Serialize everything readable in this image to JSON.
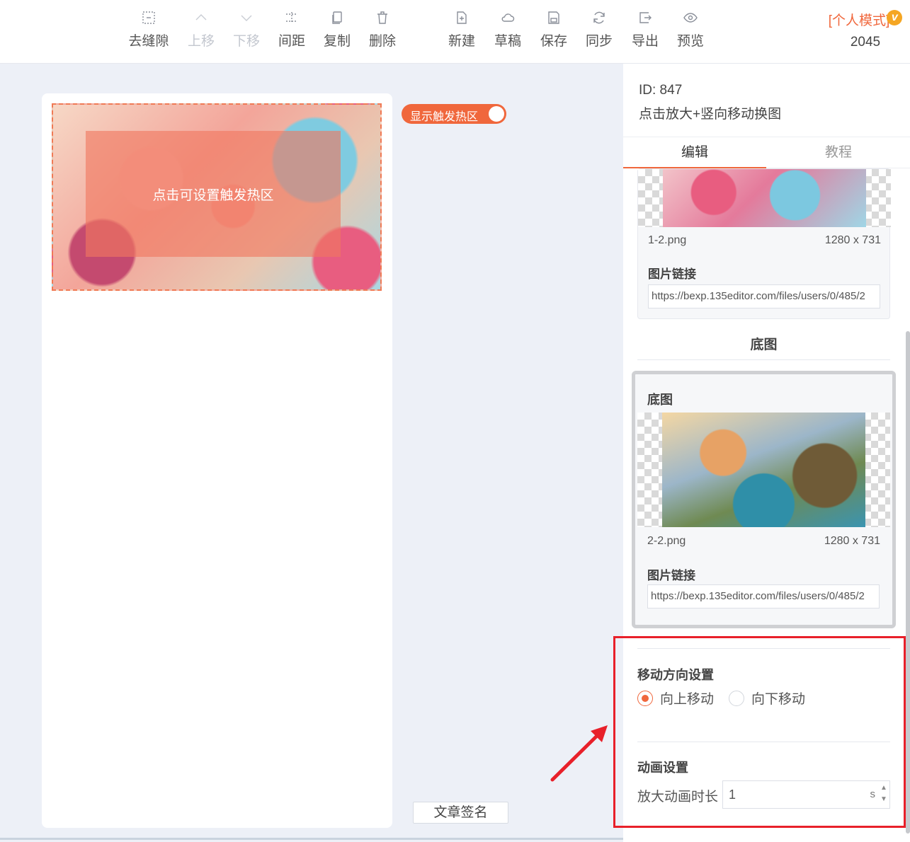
{
  "toolbar": {
    "buttons": [
      {
        "label": "去缝隙",
        "icon": "gap-icon"
      },
      {
        "label": "上移",
        "icon": "chevron-up-icon"
      },
      {
        "label": "下移",
        "icon": "chevron-down-icon"
      },
      {
        "label": "间距",
        "icon": "spacing-icon"
      },
      {
        "label": "复制",
        "icon": "copy-icon"
      },
      {
        "label": "删除",
        "icon": "trash-icon"
      },
      {
        "label": "新建",
        "icon": "new-file-icon"
      },
      {
        "label": "草稿",
        "icon": "cloud-icon"
      },
      {
        "label": "保存",
        "icon": "save-icon"
      },
      {
        "label": "同步",
        "icon": "sync-icon"
      },
      {
        "label": "导出",
        "icon": "export-icon"
      },
      {
        "label": "预览",
        "icon": "eye-icon"
      }
    ],
    "mode_label": "[个人模式]",
    "badge": "v",
    "count": "2045"
  },
  "canvas": {
    "hotzone_text": "点击可设置触发热区",
    "toggle_label": "显示触发热区",
    "sign_button": "文章签名"
  },
  "panel": {
    "id_text": "ID: 847",
    "title": "点击放大+竖向移动换图",
    "tabs": [
      "编辑",
      "教程"
    ],
    "top_image": {
      "filename": "1-2.png",
      "size": "1280 x 731",
      "link_label": "图片链接",
      "url": "https://bexp.135editor.com/files/users/0/485/2"
    },
    "base_section_title": "底图",
    "base_image": {
      "title": "底图",
      "filename": "2-2.png",
      "size": "1280 x 731",
      "link_label": "图片链接",
      "url": "https://bexp.135editor.com/files/users/0/485/2"
    },
    "direction": {
      "title": "移动方向设置",
      "options": [
        "向上移动",
        "向下移动"
      ],
      "selected": "向上移动"
    },
    "animation": {
      "title": "动画设置",
      "duration_label": "放大动画时长",
      "duration_value": "1",
      "unit": "s"
    }
  },
  "colors": {
    "accent": "#f0673c",
    "annotation": "#e8202a"
  }
}
